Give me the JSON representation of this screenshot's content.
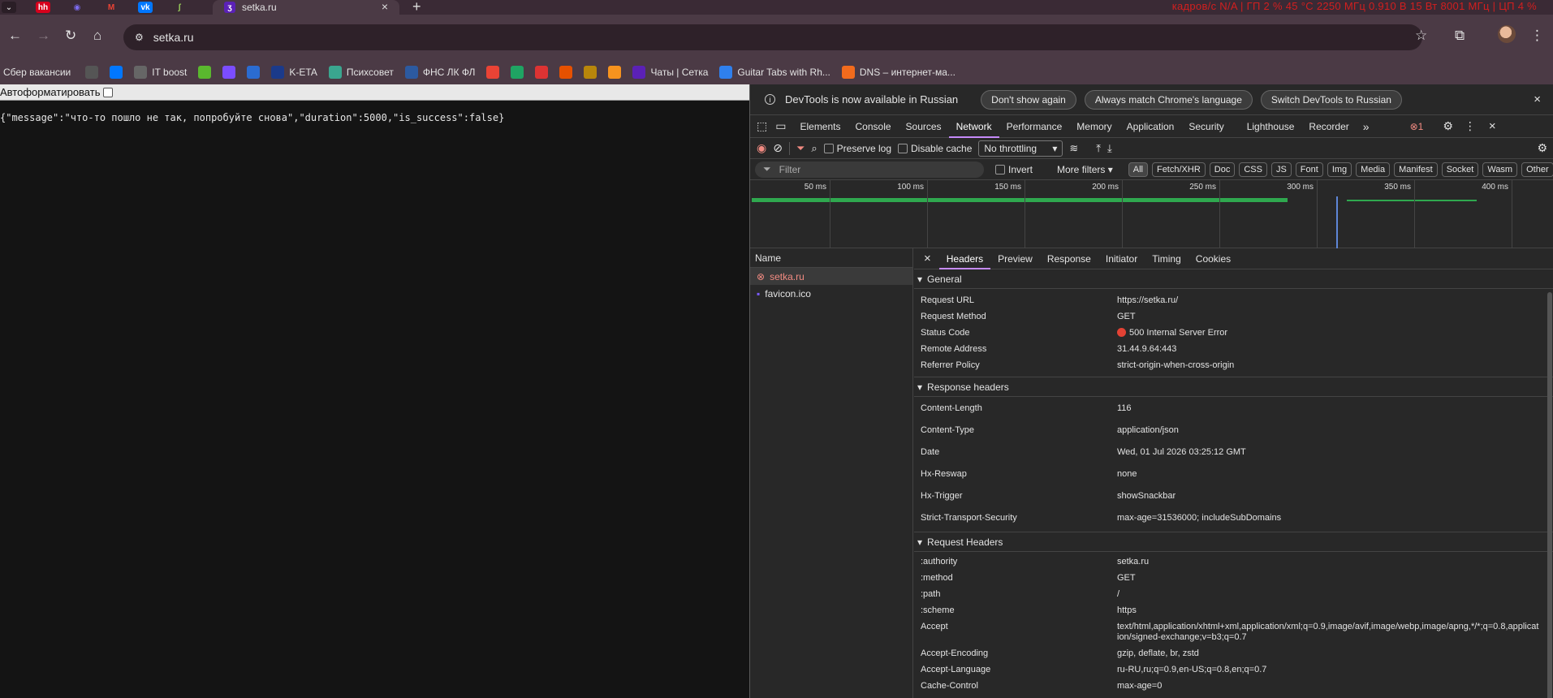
{
  "tabs": {
    "active_title": "setka.ru",
    "favicons": [
      "hh",
      "tor",
      "M",
      "vk",
      "leaf"
    ],
    "new_tab": "+"
  },
  "sysmon": "кадров/с  N/A  |  ГП  2 %  45 °C  2250 МГц  0.910 В  15 Вт  8001 МГц  |  ЦП  4 %",
  "omnibox": {
    "url": "setka.ru"
  },
  "bookmarks": [
    {
      "label": "Сбер вакансии",
      "color": "#21a038"
    },
    {
      "label": "",
      "color": "#555"
    },
    {
      "label": "",
      "color": "#0077ff"
    },
    {
      "label": "IT boost",
      "color": "#666"
    },
    {
      "label": "",
      "color": "#5ab82e"
    },
    {
      "label": "",
      "color": "#7b4dff"
    },
    {
      "label": "",
      "color": "#2b6cd1"
    },
    {
      "label": "K-ETA",
      "color": "#1b3a8a"
    },
    {
      "label": "Психсовет",
      "color": "#3aa68f"
    },
    {
      "label": "ФНС ЛК ФЛ",
      "color": "#2c5aa0"
    },
    {
      "label": "",
      "color": "#ea4335"
    },
    {
      "label": "",
      "color": "#1fa463"
    },
    {
      "label": "",
      "color": "#d33"
    },
    {
      "label": "",
      "color": "#e65100"
    },
    {
      "label": "",
      "color": "#b8860b"
    },
    {
      "label": "",
      "color": "#f7931e"
    },
    {
      "label": "Чаты | Сетка",
      "color": "#5b21b6"
    },
    {
      "label": "Guitar Tabs with Rh...",
      "color": "#2f80ed"
    },
    {
      "label": "DNS – интернет-ма...",
      "color": "#f26b1d"
    }
  ],
  "page": {
    "autoformat_label": "Автоформатировать",
    "json_text": "{\"message\":\"что-то пошло не так, попробуйте снова\",\"duration\":5000,\"is_success\":false}"
  },
  "devtools": {
    "infobar": {
      "message": "DevTools is now available in Russian",
      "btn_dont_show": "Don't show again",
      "btn_match": "Always match Chrome's language",
      "btn_switch": "Switch DevTools to Russian"
    },
    "tabs": [
      "Elements",
      "Console",
      "Sources",
      "Network",
      "Performance",
      "Memory",
      "Application",
      "Security",
      "Lighthouse",
      "Recorder"
    ],
    "active_tab": "Network",
    "error_count": "1",
    "net_toolbar": {
      "preserve_log": "Preserve log",
      "disable_cache": "Disable cache",
      "throttling": "No throttling"
    },
    "filter": {
      "placeholder": "Filter",
      "invert": "Invert",
      "more_filters": "More filters",
      "types": [
        "All",
        "Fetch/XHR",
        "Doc",
        "CSS",
        "JS",
        "Font",
        "Img",
        "Media",
        "Manifest",
        "Socket",
        "Wasm",
        "Other"
      ]
    },
    "timeline_ticks": [
      "50 ms",
      "100 ms",
      "150 ms",
      "200 ms",
      "250 ms",
      "300 ms",
      "350 ms",
      "400 ms"
    ],
    "requests_header": "Name",
    "requests": [
      {
        "name": "setka.ru",
        "error": true
      },
      {
        "name": "favicon.ico",
        "error": false
      }
    ],
    "detail_tabs": [
      "Headers",
      "Preview",
      "Response",
      "Initiator",
      "Timing",
      "Cookies"
    ],
    "general_title": "General",
    "general": [
      {
        "k": "Request URL",
        "v": "https://setka.ru/"
      },
      {
        "k": "Request Method",
        "v": "GET"
      },
      {
        "k": "Status Code",
        "v": "500 Internal Server Error"
      },
      {
        "k": "Remote Address",
        "v": "31.44.9.64:443"
      },
      {
        "k": "Referrer Policy",
        "v": "strict-origin-when-cross-origin"
      }
    ],
    "response_title": "Response headers",
    "response_headers": [
      {
        "k": "Content-Length",
        "v": "116"
      },
      {
        "k": "Content-Type",
        "v": "application/json"
      },
      {
        "k": "Date",
        "v": "Wed, 01 Jul 2026 03:25:12 GMT"
      },
      {
        "k": "Hx-Reswap",
        "v": "none"
      },
      {
        "k": "Hx-Trigger",
        "v": "showSnackbar"
      },
      {
        "k": "Strict-Transport-Security",
        "v": "max-age=31536000; includeSubDomains"
      }
    ],
    "request_title": "Request Headers",
    "request_headers": [
      {
        "k": ":authority",
        "v": "setka.ru"
      },
      {
        "k": ":method",
        "v": "GET"
      },
      {
        "k": ":path",
        "v": "/"
      },
      {
        "k": ":scheme",
        "v": "https"
      },
      {
        "k": "Accept",
        "v": "text/html,application/xhtml+xml,application/xml;q=0.9,image/avif,image/webp,image/apng,*/*;q=0.8,application/signed-exchange;v=b3;q=0.7"
      },
      {
        "k": "Accept-Encoding",
        "v": "gzip, deflate, br, zstd"
      },
      {
        "k": "Accept-Language",
        "v": "ru-RU,ru;q=0.9,en-US;q=0.8,en;q=0.7"
      },
      {
        "k": "Cache-Control",
        "v": "max-age=0"
      }
    ]
  }
}
